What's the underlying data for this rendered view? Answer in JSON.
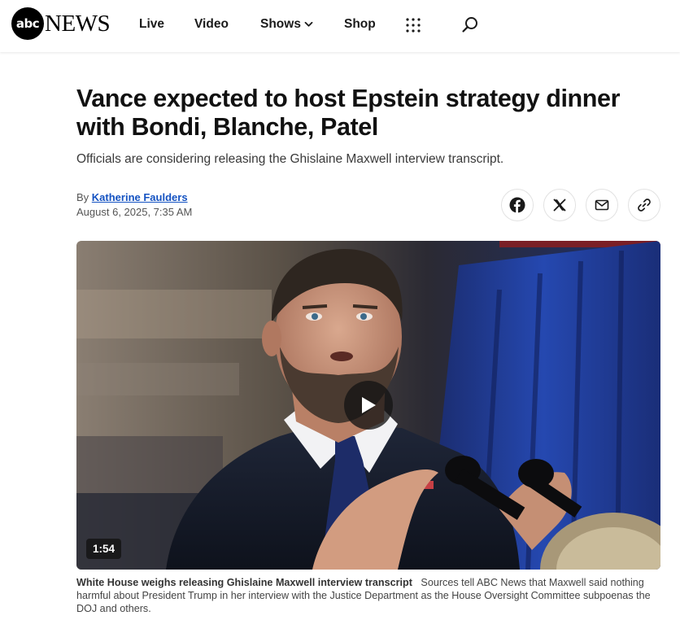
{
  "header": {
    "logo": {
      "circle_text": "abc",
      "word_text": "NEWS"
    },
    "nav": {
      "live": "Live",
      "video": "Video",
      "shows": "Shows",
      "shop": "Shop"
    },
    "icons": [
      "chevron-down-icon",
      "grid-menu-icon",
      "search-icon"
    ]
  },
  "article": {
    "headline": "Vance expected to host Epstein strategy dinner with Bondi, Blanche, Patel",
    "subhead": "Officials are considering releasing the Ghislaine Maxwell interview transcript.",
    "byline_prefix": "By ",
    "author": "Katherine Faulders",
    "date": "August 6, 2025, 7:35 AM"
  },
  "share": {
    "icons": [
      "facebook-icon",
      "x-icon",
      "mail-icon",
      "link-icon"
    ]
  },
  "video": {
    "duration": "1:54",
    "caption_title": "White House weighs releasing Ghislaine Maxwell interview transcript",
    "caption_text": "Sources tell ABC News that Maxwell said nothing harmful about President Trump in her interview with the Justice Department as the House Oversight Committee subpoenas the DOJ and others."
  },
  "colors": {
    "author_link": "#1452c2",
    "text_dark": "#111111",
    "text_muted": "#555555"
  }
}
